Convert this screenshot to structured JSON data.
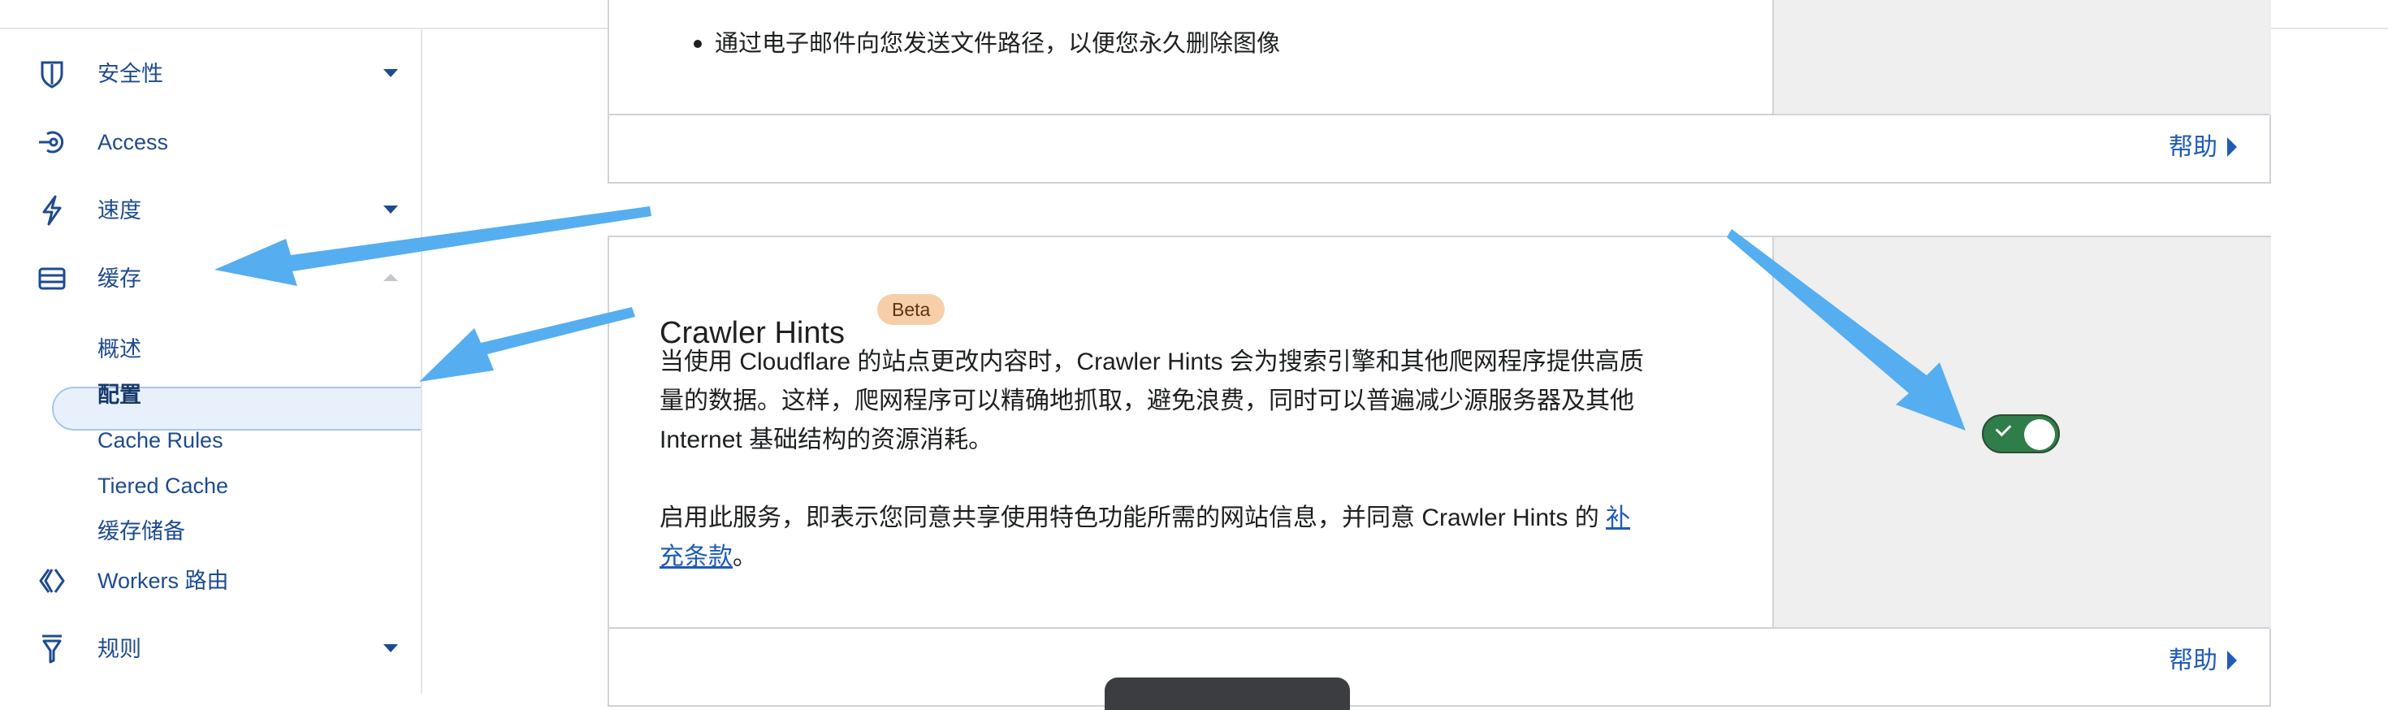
{
  "sidebar": {
    "items": [
      {
        "label": "安全性",
        "icon": "shield-icon"
      },
      {
        "label": "Access",
        "icon": "access-icon"
      },
      {
        "label": "速度",
        "icon": "lightning-icon"
      },
      {
        "label": "缓存",
        "icon": "cache-stack-icon"
      },
      {
        "label": "Workers 路由",
        "icon": "workers-icon"
      },
      {
        "label": "规则",
        "icon": "rules-funnel-icon"
      }
    ],
    "cache_sub": [
      "概述",
      "配置",
      "Cache Rules",
      "Tiered Cache",
      "缓存储备"
    ]
  },
  "top_card": {
    "bullet": "通过电子邮件向您发送文件路径，以便您永久删除图像",
    "help": "帮助"
  },
  "crawler_card": {
    "title": "Crawler Hints",
    "badge": "Beta",
    "desc1_line1": "当使用 Cloudflare 的站点更改内容时，Crawler Hints 会为搜索引擎和其他爬网程序提供高质",
    "desc1_line2": "量的数据。这样，爬网程序可以精确地抓取，避免浪费，同时可以普遍减少源服务器及其他",
    "desc1_line3": "Internet 基础结构的资源消耗。",
    "desc2_line1_text": "启用此服务，即表示您同意共享使用特色功能所需的网站信息，并同意 Crawler Hints 的 ",
    "desc2_link_part1": "补",
    "desc2_link_part2": "充条款",
    "desc2_end": "。",
    "toggle_on": true,
    "help": "帮助"
  },
  "colors": {
    "accent": "#1f5bb8",
    "toggle_on": "#2f7d48",
    "badge": "#f6cfa9",
    "annotation_arrow": "#55aef0"
  }
}
